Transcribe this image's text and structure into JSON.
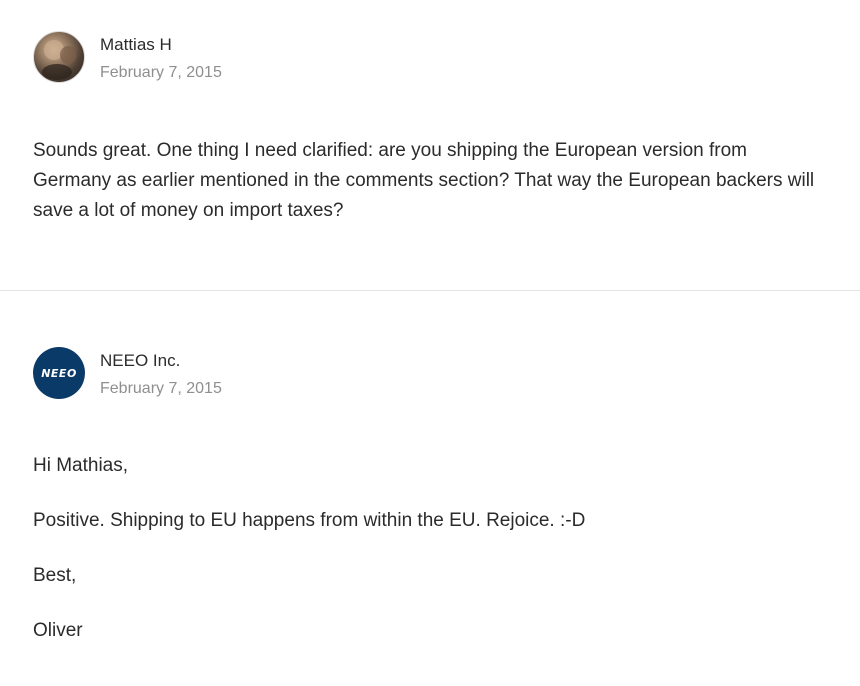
{
  "comments": [
    {
      "author": "Mattias H",
      "date": "February 7, 2015",
      "avatar_icon": "user-photo-avatar",
      "paragraphs": [
        "Sounds great. One thing I need clarified: are you shipping the European version from Germany as earlier mentioned in the comments section? That way the European backers will save a lot of money on import taxes?"
      ]
    },
    {
      "author": "NEEO Inc.",
      "date": "February 7, 2015",
      "avatar_icon": "neeo-logo-avatar",
      "avatar_text": "NEEO",
      "avatar_color": "#0a3a67",
      "paragraphs": [
        "Hi Mathias,",
        "Positive. Shipping to EU happens from within the EU. Rejoice. :-D",
        "Best,",
        "Oliver"
      ]
    }
  ]
}
